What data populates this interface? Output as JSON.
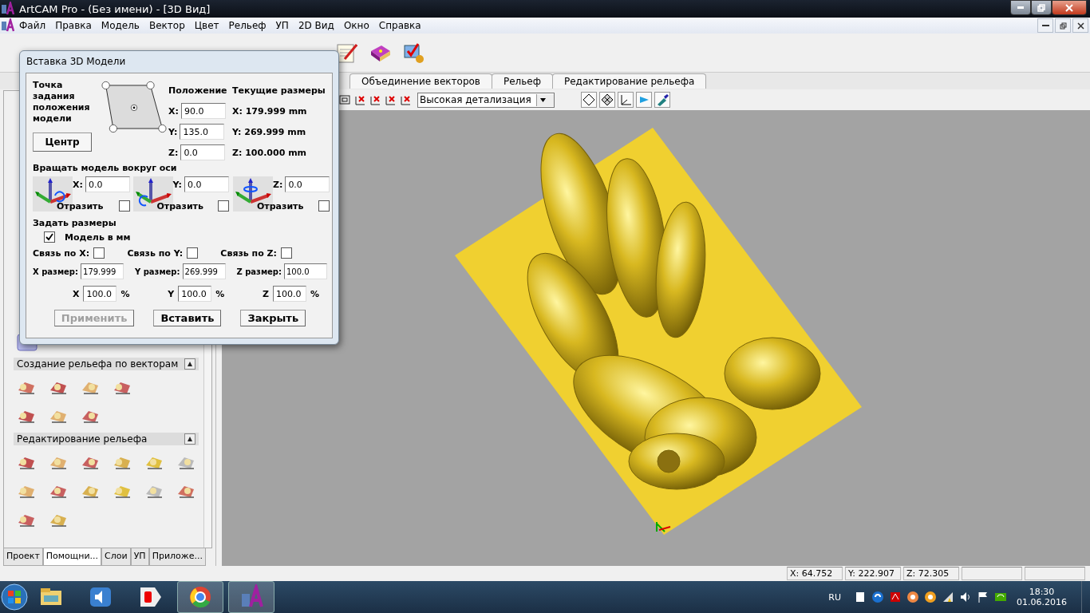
{
  "window": {
    "title": "ArtCAM Pro - (Без имени) - [3D Вид]"
  },
  "menu": [
    "Файл",
    "Правка",
    "Модель",
    "Вектор",
    "Цвет",
    "Рельеф",
    "УП",
    "2D Вид",
    "Окно",
    "Справка"
  ],
  "ribbon_tabs": [
    "Объединение векторов",
    "Рельеф",
    "Редактирование рельефа"
  ],
  "view_toolbar": {
    "detail_select": "Высокая детализация"
  },
  "left_panel": {
    "sections": [
      {
        "title": "Создание рельефа по векторам"
      },
      {
        "title": "Редактирование рельефа"
      }
    ],
    "tabs": [
      {
        "label": "Проект",
        "selected": false
      },
      {
        "label": "Помощни...",
        "selected": true
      },
      {
        "label": "Слои",
        "selected": false
      },
      {
        "label": "УП",
        "selected": false
      },
      {
        "label": "Приложе...",
        "selected": false
      }
    ]
  },
  "dialog": {
    "title": "Вставка 3D Модели",
    "anchor_label": "Точка задания положения модели",
    "center_button": "Центр",
    "position_header": "Положение",
    "current_header": "Текущие размеры",
    "position": [
      {
        "label": "X:",
        "value": "90.0",
        "current": "X:  179.999 mm"
      },
      {
        "label": "Y:",
        "value": "135.0",
        "current": "Y:  269.999 mm"
      },
      {
        "label": "Z:",
        "value": "0.0",
        "current": "Z:  100.000 mm"
      }
    ],
    "rotate_header": "Вращать модель вокруг оси",
    "rotate": [
      {
        "label": "X:",
        "value": "0.0",
        "mirror_label": "Отразить",
        "checked": false
      },
      {
        "label": "Y:",
        "value": "0.0",
        "mirror_label": "Отразить",
        "checked": false
      },
      {
        "label": "Z:",
        "value": "0.0",
        "mirror_label": "Отразить",
        "checked": false
      }
    ],
    "size_header": "Задать размеры",
    "model_mm": {
      "label": "Модель в мм",
      "checked": true
    },
    "links": [
      {
        "label": "Связь по X:",
        "checked": false
      },
      {
        "label": "Связь по Y:",
        "checked": false
      },
      {
        "label": "Связь по Z:",
        "checked": false
      }
    ],
    "sizes": [
      {
        "label": "X размер:",
        "value": "179.999"
      },
      {
        "label": "Y размер:",
        "value": "269.999"
      },
      {
        "label": "Z размер:",
        "value": "100.0"
      }
    ],
    "percents": [
      {
        "label": "X",
        "value": "100.0",
        "unit": "%"
      },
      {
        "label": "Y",
        "value": "100.0",
        "unit": "%"
      },
      {
        "label": "Z",
        "value": "100.0",
        "unit": "%"
      }
    ],
    "buttons": [
      {
        "label": "Применить",
        "disabled": true
      },
      {
        "label": "Вставить",
        "disabled": false
      },
      {
        "label": "Закрыть",
        "disabled": false
      }
    ]
  },
  "status_bar": [
    "X: 64.752",
    "Y: 222.907",
    "Z: 72.305"
  ],
  "taskbar": {
    "language": "RU",
    "time": "18:30",
    "date": "01.06.2016"
  }
}
